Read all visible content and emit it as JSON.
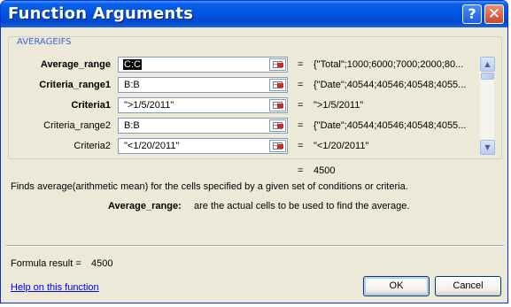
{
  "window": {
    "title": "Function Arguments"
  },
  "titlebar_buttons": {
    "help": "?",
    "close": "✕"
  },
  "function_group": {
    "name": "AVERAGEIFS"
  },
  "arguments": [
    {
      "label": "Average_range",
      "value": "C:C",
      "preview": "{\"Total\";1000;6000;7000;2000;80..."
    },
    {
      "label": "Criteria_range1",
      "value": "B:B",
      "preview": "{\"Date\";40544;40546;40548;4055..."
    },
    {
      "label": "Criteria1",
      "value": "\">1/5/2011\"",
      "preview": "\">1/5/2011\""
    },
    {
      "label": "Criteria_range2",
      "value": "B:B",
      "preview": "{\"Date\";40544;40546;40548;4055..."
    },
    {
      "label": "Criteria2",
      "value": "\"<1/20/2011\"",
      "preview": "\"<1/20/2011\""
    }
  ],
  "equals_sign": "=",
  "function_result": "4500",
  "description": "Finds average(arithmetic mean) for the cells specified by a given set of conditions or criteria.",
  "argument_help": {
    "name": "Average_range:",
    "text": "are the actual cells to be used to find the average."
  },
  "formula_result": {
    "label": "Formula result =",
    "value": "4500"
  },
  "help_link": "Help on this function",
  "buttons": {
    "ok": "OK",
    "cancel": "Cancel"
  },
  "scrollbar": {
    "up": "▲",
    "down": "▼"
  }
}
